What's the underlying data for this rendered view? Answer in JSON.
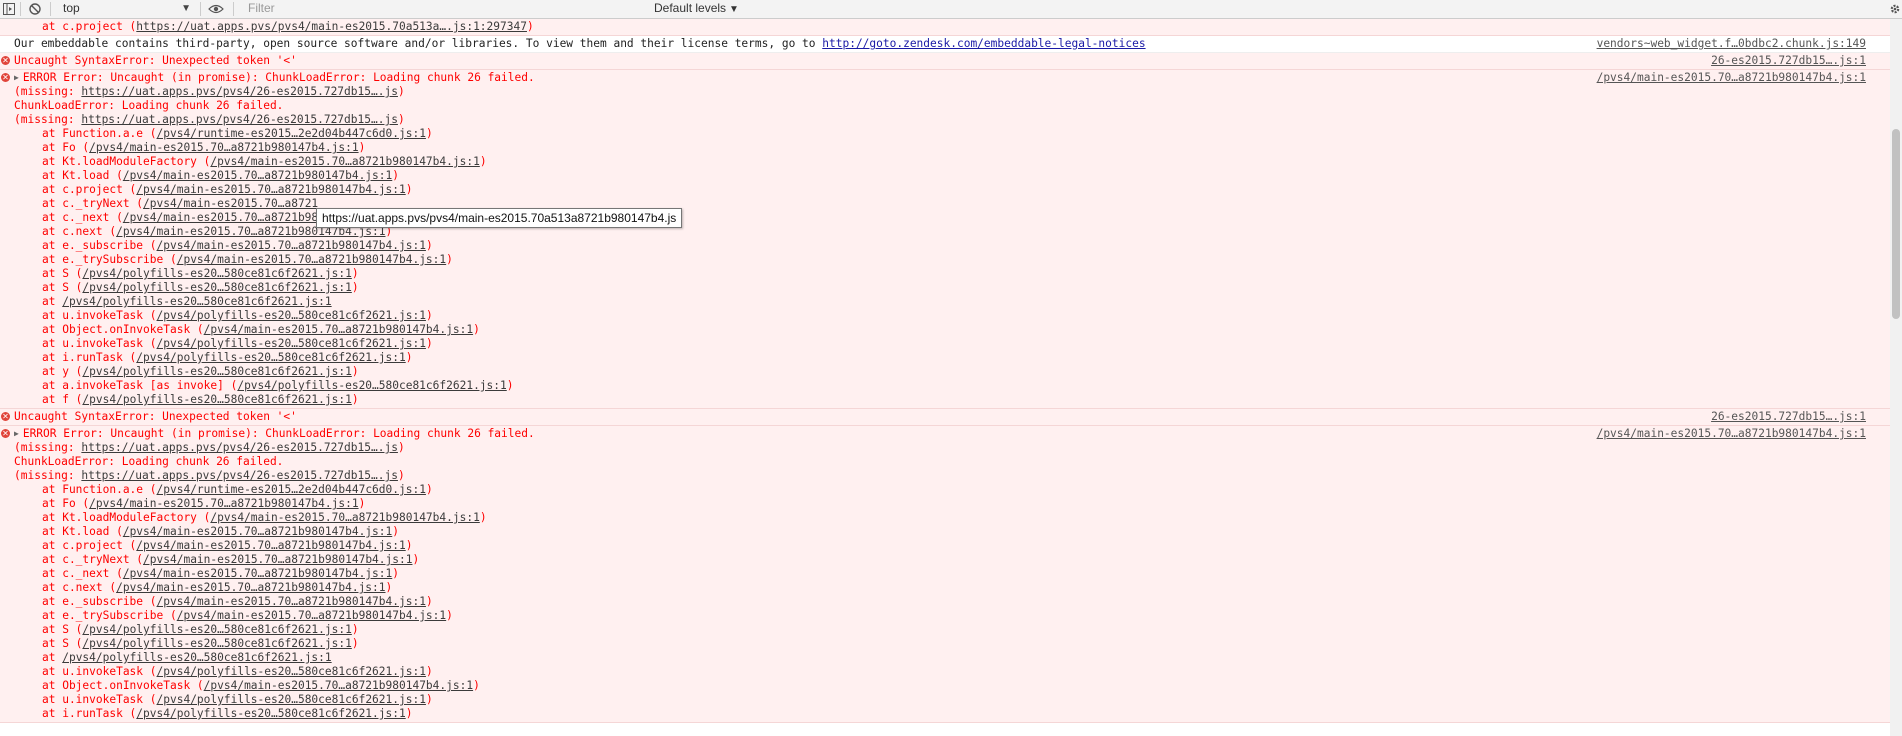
{
  "toolbar": {
    "context": "top",
    "filter_placeholder": "Filter",
    "levels_label": "Default levels",
    "caret": "▼"
  },
  "icons": {
    "sidebar": "sidebar-icon",
    "clear": "clear-console-icon",
    "eye": "eye-icon",
    "gear": "gear-icon",
    "error": "error-icon"
  },
  "tooltip": "https://uat.apps.pvs/pvs4/main-es2015.70a513a8721b980147b4.js",
  "top_fragment": {
    "prefix": "at c.project (",
    "link": "https://uat.apps.pvs/pvs4/main-es2015.70a513a….js:1:297347",
    "suffix": ")"
  },
  "info_message": {
    "text": "Our embeddable contains third-party, open source software and/or libraries. To view them and their license terms, go to ",
    "link": "http://goto.zendesk.com/embeddable-legal-notices",
    "source": "vendors~web_widget.f…0bdbc2.chunk.js:149"
  },
  "syntax_error": {
    "text": "Uncaught SyntaxError: Unexpected token '<'",
    "source": "26-es2015.727db15….js:1"
  },
  "chunk_error": {
    "header": "ERROR Error: Uncaught (in promise): ChunkLoadError: Loading chunk 26 failed.",
    "source": "/pvs4/main-es2015.70…a8721b980147b4.js:1",
    "missing_prefix": "(missing: ",
    "missing_link": "https://uat.apps.pvs/pvs4/26-es2015.727db15….js",
    "missing_suffix": ")",
    "chunk_line": "ChunkLoadError: Loading chunk 26 failed."
  },
  "stack1": [
    {
      "fn": "at Function.a.e (",
      "link": "/pvs4/runtime-es2015…2e2d04b447c6d0.js:1",
      "end": ")"
    },
    {
      "fn": "at Fo (",
      "link": "/pvs4/main-es2015.70…a8721b980147b4.js:1",
      "end": ")"
    },
    {
      "fn": "at Kt.loadModuleFactory (",
      "link": "/pvs4/main-es2015.70…a8721b980147b4.js:1",
      "end": ")"
    },
    {
      "fn": "at Kt.load (",
      "link": "/pvs4/main-es2015.70…a8721b980147b4.js:1",
      "end": ")"
    },
    {
      "fn": "at c.project (",
      "link": "/pvs4/main-es2015.70…a8721b980147b4.js:1",
      "end": ")"
    },
    {
      "fn": "at c._tryNext (",
      "link": "/pvs4/main-es2015.70…a8721",
      "end": ""
    },
    {
      "fn": "at c._next (",
      "link": "/pvs4/main-es2015.70…a8721b98",
      "end": ""
    },
    {
      "fn": "at c.next (",
      "link": "/pvs4/main-es2015.70…a8721b980147b4.js:1",
      "end": ")"
    },
    {
      "fn": "at e._subscribe (",
      "link": "/pvs4/main-es2015.70…a8721b980147b4.js:1",
      "end": ")"
    },
    {
      "fn": "at e._trySubscribe (",
      "link": "/pvs4/main-es2015.70…a8721b980147b4.js:1",
      "end": ")"
    },
    {
      "fn": "at S (",
      "link": "/pvs4/polyfills-es20…580ce81c6f2621.js:1",
      "end": ")"
    },
    {
      "fn": "at S (",
      "link": "/pvs4/polyfills-es20…580ce81c6f2621.js:1",
      "end": ")"
    },
    {
      "fn": "at ",
      "link": "/pvs4/polyfills-es20…580ce81c6f2621.js:1",
      "end": ""
    },
    {
      "fn": "at u.invokeTask (",
      "link": "/pvs4/polyfills-es20…580ce81c6f2621.js:1",
      "end": ")"
    },
    {
      "fn": "at Object.onInvokeTask (",
      "link": "/pvs4/main-es2015.70…a8721b980147b4.js:1",
      "end": ")"
    },
    {
      "fn": "at u.invokeTask (",
      "link": "/pvs4/polyfills-es20…580ce81c6f2621.js:1",
      "end": ")"
    },
    {
      "fn": "at i.runTask (",
      "link": "/pvs4/polyfills-es20…580ce81c6f2621.js:1",
      "end": ")"
    },
    {
      "fn": "at y (",
      "link": "/pvs4/polyfills-es20…580ce81c6f2621.js:1",
      "end": ")"
    },
    {
      "fn": "at a.invokeTask [as invoke] (",
      "link": "/pvs4/polyfills-es20…580ce81c6f2621.js:1",
      "end": ")"
    },
    {
      "fn": "at f (",
      "link": "/pvs4/polyfills-es20…580ce81c6f2621.js:1",
      "end": ")"
    }
  ],
  "stack2": [
    {
      "fn": "at Function.a.e (",
      "link": "/pvs4/runtime-es2015…2e2d04b447c6d0.js:1",
      "end": ")"
    },
    {
      "fn": "at Fo (",
      "link": "/pvs4/main-es2015.70…a8721b980147b4.js:1",
      "end": ")"
    },
    {
      "fn": "at Kt.loadModuleFactory (",
      "link": "/pvs4/main-es2015.70…a8721b980147b4.js:1",
      "end": ")"
    },
    {
      "fn": "at Kt.load (",
      "link": "/pvs4/main-es2015.70…a8721b980147b4.js:1",
      "end": ")"
    },
    {
      "fn": "at c.project (",
      "link": "/pvs4/main-es2015.70…a8721b980147b4.js:1",
      "end": ")"
    },
    {
      "fn": "at c._tryNext (",
      "link": "/pvs4/main-es2015.70…a8721b980147b4.js:1",
      "end": ")"
    },
    {
      "fn": "at c._next (",
      "link": "/pvs4/main-es2015.70…a8721b980147b4.js:1",
      "end": ")"
    },
    {
      "fn": "at c.next (",
      "link": "/pvs4/main-es2015.70…a8721b980147b4.js:1",
      "end": ")"
    },
    {
      "fn": "at e._subscribe (",
      "link": "/pvs4/main-es2015.70…a8721b980147b4.js:1",
      "end": ")"
    },
    {
      "fn": "at e._trySubscribe (",
      "link": "/pvs4/main-es2015.70…a8721b980147b4.js:1",
      "end": ")"
    },
    {
      "fn": "at S (",
      "link": "/pvs4/polyfills-es20…580ce81c6f2621.js:1",
      "end": ")"
    },
    {
      "fn": "at S (",
      "link": "/pvs4/polyfills-es20…580ce81c6f2621.js:1",
      "end": ")"
    },
    {
      "fn": "at ",
      "link": "/pvs4/polyfills-es20…580ce81c6f2621.js:1",
      "end": ""
    },
    {
      "fn": "at u.invokeTask (",
      "link": "/pvs4/polyfills-es20…580ce81c6f2621.js:1",
      "end": ")"
    },
    {
      "fn": "at Object.onInvokeTask (",
      "link": "/pvs4/main-es2015.70…a8721b980147b4.js:1",
      "end": ")"
    },
    {
      "fn": "at u.invokeTask (",
      "link": "/pvs4/polyfills-es20…580ce81c6f2621.js:1",
      "end": ")"
    },
    {
      "fn": "at i.runTask (",
      "link": "/pvs4/polyfills-es20…580ce81c6f2621.js:1",
      "end": ")"
    }
  ]
}
